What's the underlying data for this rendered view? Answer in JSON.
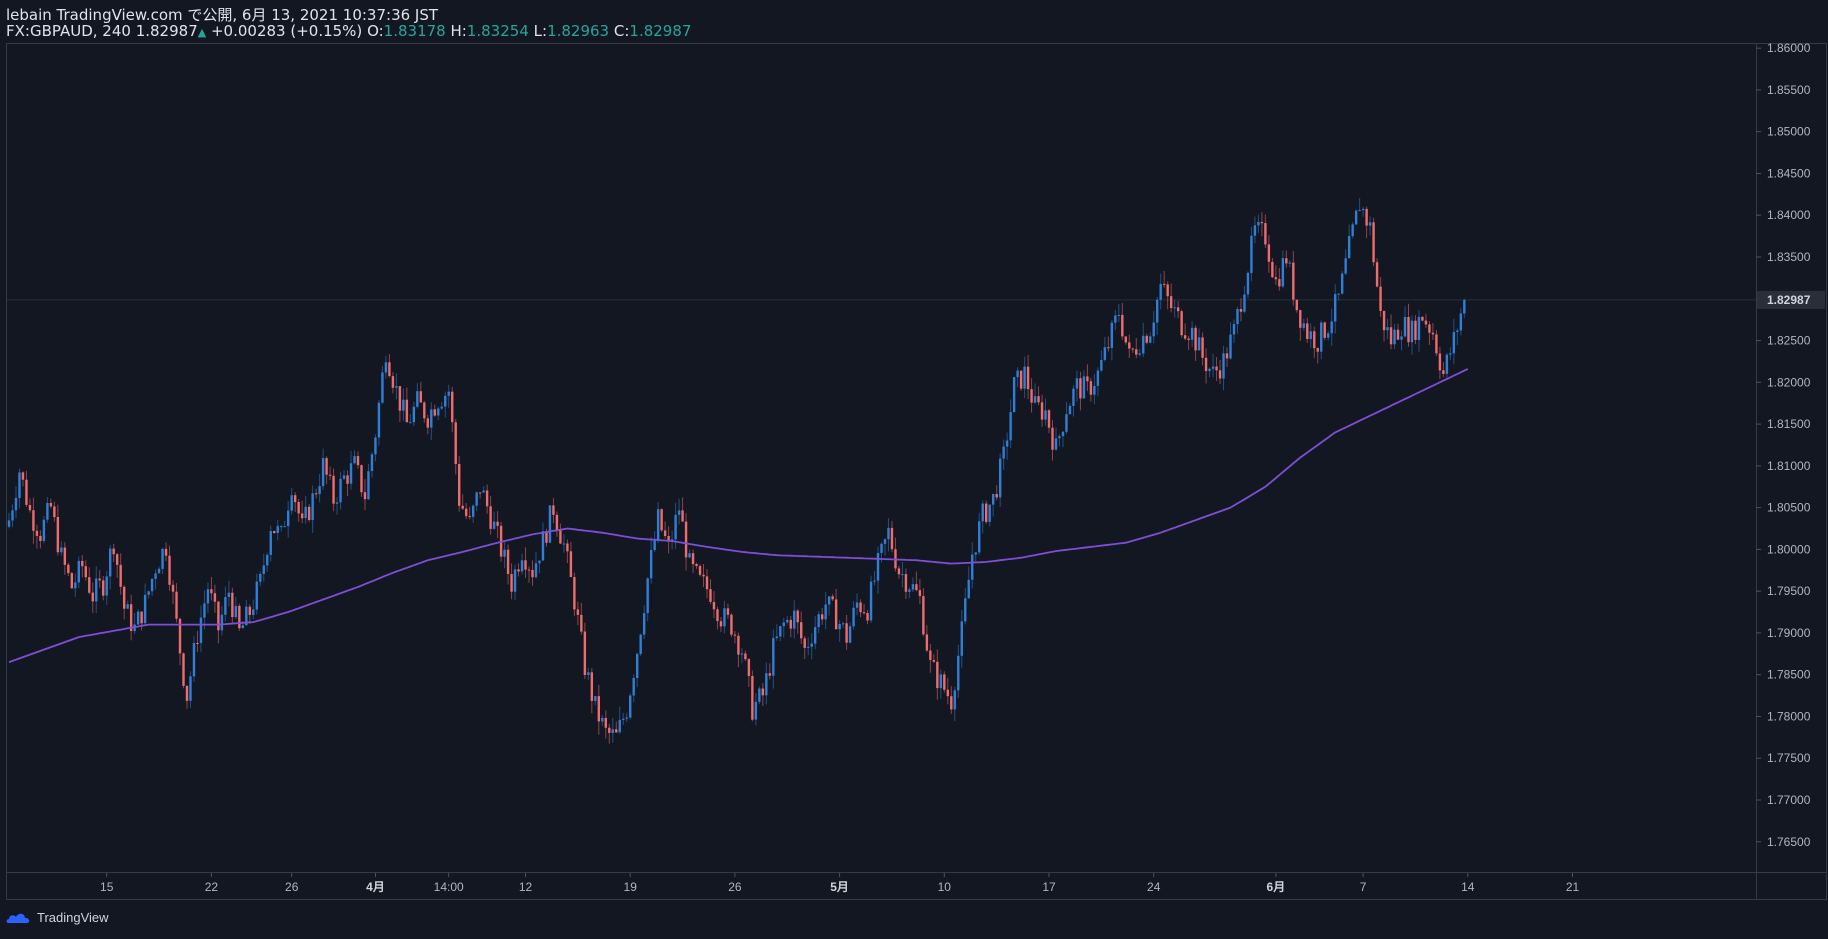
{
  "header": {
    "published": "lebain TradingView.com で公開, 6月 13, 2021 10:37:36 JST",
    "symbol": "FX:GBPAUD, 240",
    "last": "1.82987",
    "change_arrow": "▲",
    "change": "+0.00283 (+0.15%)",
    "o_label": "O:",
    "o_value": "1.83178",
    "h_label": "H:",
    "h_value": "1.83254",
    "l_label": "L:",
    "l_value": "1.82963",
    "c_label": "C:",
    "c_value": "1.82987"
  },
  "footer": {
    "brand": "TradingView"
  },
  "colors": {
    "background": "#131722",
    "up": "#2f7fd6",
    "down": "#ef6c6c",
    "ma": "#7e4fd6",
    "axis_text": "#b2b5be",
    "price_badge": "#2a2e39"
  },
  "chart_data": {
    "type": "candlestick",
    "symbol": "FX:GBPAUD",
    "interval": "240",
    "ylim": [
      1.7615,
      1.8605
    ],
    "price_ticks": [
      1.765,
      1.77,
      1.775,
      1.78,
      1.785,
      1.79,
      1.795,
      1.8,
      1.805,
      1.81,
      1.815,
      1.82,
      1.825,
      1.83,
      1.835,
      1.84,
      1.845,
      1.85,
      1.855,
      1.86
    ],
    "price_tick_labels": [
      "1.76500",
      "1.77000",
      "1.77500",
      "1.78000",
      "1.78500",
      "1.79000",
      "1.79500",
      "1.80000",
      "1.80500",
      "1.81000",
      "1.81500",
      "1.82000",
      "1.82500",
      "1.83000",
      "1.83500",
      "1.84000",
      "1.84500",
      "1.85000",
      "1.85500",
      "1.86000"
    ],
    "last_price": 1.82987,
    "last_price_label": "1.82987",
    "time_ticks": [
      {
        "label": "15",
        "bar": 28,
        "bold": false
      },
      {
        "label": "22",
        "bar": 58,
        "bold": false
      },
      {
        "label": "26",
        "bar": 81,
        "bold": false
      },
      {
        "label": "4月",
        "bar": 105,
        "bold": true
      },
      {
        "label": "14:00",
        "bar": 126,
        "bold": false
      },
      {
        "label": "12",
        "bar": 148,
        "bold": false
      },
      {
        "label": "19",
        "bar": 178,
        "bold": false
      },
      {
        "label": "26",
        "bar": 208,
        "bold": false
      },
      {
        "label": "5月",
        "bar": 238,
        "bold": true
      },
      {
        "label": "10",
        "bar": 268,
        "bold": false
      },
      {
        "label": "17",
        "bar": 298,
        "bold": false
      },
      {
        "label": "24",
        "bar": 328,
        "bold": false
      },
      {
        "label": "6月",
        "bar": 363,
        "bold": true
      },
      {
        "label": "7",
        "bar": 388,
        "bold": false
      },
      {
        "label": "14",
        "bar": 418,
        "bold": false
      },
      {
        "label": "21",
        "bar": 448,
        "bold": false
      }
    ],
    "total_bars": 418,
    "anchors": [
      [
        0,
        1.8035
      ],
      [
        3,
        1.8095
      ],
      [
        6,
        1.8045
      ],
      [
        9,
        1.802
      ],
      [
        12,
        1.805
      ],
      [
        15,
        1.799
      ],
      [
        18,
        1.7955
      ],
      [
        21,
        1.798
      ],
      [
        24,
        1.7945
      ],
      [
        27,
        1.796
      ],
      [
        30,
        1.801
      ],
      [
        33,
        1.793
      ],
      [
        36,
        1.7905
      ],
      [
        39,
        1.7935
      ],
      [
        42,
        1.798
      ],
      [
        45,
        1.8005
      ],
      [
        48,
        1.791
      ],
      [
        50,
        1.785
      ],
      [
        51,
        1.7825
      ],
      [
        54,
        1.79
      ],
      [
        57,
        1.7955
      ],
      [
        60,
        1.7905
      ],
      [
        63,
        1.795
      ],
      [
        66,
        1.79
      ],
      [
        69,
        1.7925
      ],
      [
        72,
        1.796
      ],
      [
        75,
        1.803
      ],
      [
        78,
        1.8015
      ],
      [
        81,
        1.808
      ],
      [
        84,
        1.8025
      ],
      [
        87,
        1.806
      ],
      [
        90,
        1.81
      ],
      [
        93,
        1.806
      ],
      [
        96,
        1.8085
      ],
      [
        99,
        1.81
      ],
      [
        102,
        1.8065
      ],
      [
        105,
        1.814
      ],
      [
        108,
        1.824
      ],
      [
        111,
        1.819
      ],
      [
        114,
        1.815
      ],
      [
        117,
        1.8175
      ],
      [
        120,
        1.816
      ],
      [
        123,
        1.818
      ],
      [
        126,
        1.819
      ],
      [
        129,
        1.806
      ],
      [
        132,
        1.803
      ],
      [
        135,
        1.8075
      ],
      [
        138,
        1.804
      ],
      [
        141,
        1.8
      ],
      [
        144,
        1.796
      ],
      [
        147,
        1.8
      ],
      [
        150,
        1.7975
      ],
      [
        153,
        1.801
      ],
      [
        156,
        1.805
      ],
      [
        159,
        1.8005
      ],
      [
        162,
        1.794
      ],
      [
        165,
        1.786
      ],
      [
        168,
        1.781
      ],
      [
        171,
        1.778
      ],
      [
        174,
        1.7775
      ],
      [
        177,
        1.781
      ],
      [
        180,
        1.788
      ],
      [
        183,
        1.7965
      ],
      [
        186,
        1.8035
      ],
      [
        189,
        1.8
      ],
      [
        192,
        1.805
      ],
      [
        195,
        1.798
      ],
      [
        198,
        1.796
      ],
      [
        201,
        1.795
      ],
      [
        204,
        1.792
      ],
      [
        207,
        1.791
      ],
      [
        210,
        1.788
      ],
      [
        213,
        1.781
      ],
      [
        216,
        1.7825
      ],
      [
        219,
        1.788
      ],
      [
        222,
        1.791
      ],
      [
        225,
        1.792
      ],
      [
        228,
        1.788
      ],
      [
        231,
        1.791
      ],
      [
        234,
        1.7935
      ],
      [
        237,
        1.792
      ],
      [
        240,
        1.7895
      ],
      [
        243,
        1.7935
      ],
      [
        246,
        1.793
      ],
      [
        249,
        1.798
      ],
      [
        252,
        1.802
      ],
      [
        255,
        1.7975
      ],
      [
        258,
        1.796
      ],
      [
        261,
        1.794
      ],
      [
        264,
        1.786
      ],
      [
        267,
        1.784
      ],
      [
        270,
        1.782
      ],
      [
        273,
        1.79
      ],
      [
        276,
        1.7995
      ],
      [
        279,
        1.804
      ],
      [
        282,
        1.806
      ],
      [
        285,
        1.811
      ],
      [
        288,
        1.8195
      ],
      [
        291,
        1.821
      ],
      [
        294,
        1.817
      ],
      [
        297,
        1.8165
      ],
      [
        300,
        1.812
      ],
      [
        303,
        1.817
      ],
      [
        306,
        1.8195
      ],
      [
        309,
        1.819
      ],
      [
        312,
        1.821
      ],
      [
        315,
        1.8245
      ],
      [
        318,
        1.8285
      ],
      [
        321,
        1.823
      ],
      [
        324,
        1.825
      ],
      [
        327,
        1.8265
      ],
      [
        330,
        1.8315
      ],
      [
        333,
        1.829
      ],
      [
        336,
        1.827
      ],
      [
        339,
        1.826
      ],
      [
        342,
        1.823
      ],
      [
        345,
        1.821
      ],
      [
        348,
        1.8225
      ],
      [
        351,
        1.826
      ],
      [
        354,
        1.832
      ],
      [
        357,
        1.838
      ],
      [
        360,
        1.8375
      ],
      [
        363,
        1.832
      ],
      [
        366,
        1.835
      ],
      [
        369,
        1.829
      ],
      [
        372,
        1.826
      ],
      [
        375,
        1.825
      ],
      [
        378,
        1.827
      ],
      [
        381,
        1.83
      ],
      [
        384,
        1.836
      ],
      [
        387,
        1.8415
      ],
      [
        390,
        1.8385
      ],
      [
        393,
        1.828
      ],
      [
        396,
        1.825
      ],
      [
        399,
        1.827
      ],
      [
        402,
        1.826
      ],
      [
        405,
        1.828
      ],
      [
        408,
        1.826
      ],
      [
        411,
        1.821
      ],
      [
        414,
        1.825
      ],
      [
        417,
        1.8299
      ]
    ],
    "ma_anchors": [
      [
        0,
        1.7865
      ],
      [
        20,
        1.7895
      ],
      [
        40,
        1.791
      ],
      [
        60,
        1.791
      ],
      [
        70,
        1.7913
      ],
      [
        80,
        1.7925
      ],
      [
        90,
        1.794
      ],
      [
        100,
        1.7955
      ],
      [
        110,
        1.7972
      ],
      [
        120,
        1.7987
      ],
      [
        130,
        1.7997
      ],
      [
        140,
        1.8008
      ],
      [
        150,
        1.8018
      ],
      [
        160,
        1.8025
      ],
      [
        170,
        1.802
      ],
      [
        180,
        1.8013
      ],
      [
        190,
        1.801
      ],
      [
        200,
        1.8003
      ],
      [
        210,
        1.7997
      ],
      [
        220,
        1.7993
      ],
      [
        240,
        1.799
      ],
      [
        260,
        1.7987
      ],
      [
        270,
        1.7983
      ],
      [
        280,
        1.7985
      ],
      [
        290,
        1.799
      ],
      [
        300,
        1.7998
      ],
      [
        310,
        1.8003
      ],
      [
        320,
        1.8008
      ],
      [
        330,
        1.802
      ],
      [
        340,
        1.8035
      ],
      [
        350,
        1.805
      ],
      [
        360,
        1.8075
      ],
      [
        370,
        1.811
      ],
      [
        380,
        1.814
      ],
      [
        390,
        1.816
      ],
      [
        400,
        1.818
      ],
      [
        410,
        1.82
      ],
      [
        418,
        1.8216
      ]
    ]
  }
}
